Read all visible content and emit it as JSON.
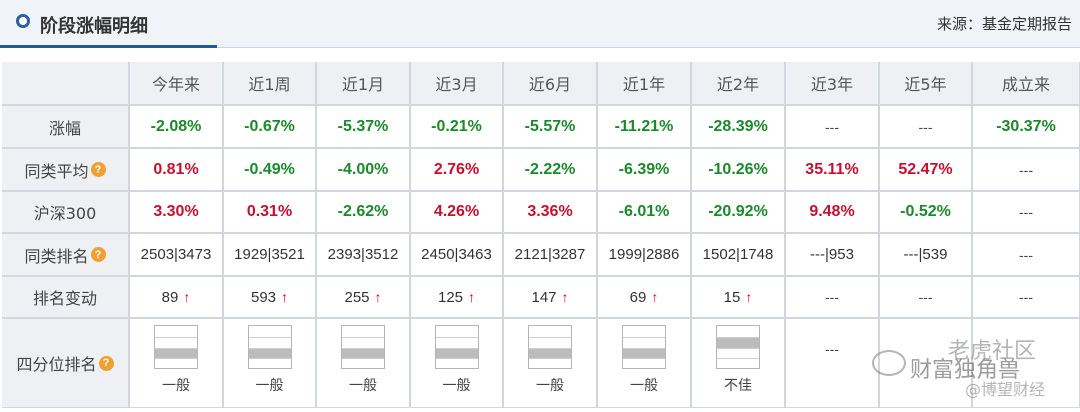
{
  "header": {
    "title": "阶段涨幅明细",
    "source": "来源：基金定期报告"
  },
  "columns": [
    "今年来",
    "近1周",
    "近1月",
    "近3月",
    "近6月",
    "近1年",
    "近2年",
    "近3年",
    "近5年",
    "成立来"
  ],
  "rows": {
    "change": {
      "label": "涨幅",
      "values": [
        "-2.08%",
        "-0.67%",
        "-5.37%",
        "-0.21%",
        "-5.57%",
        "-11.21%",
        "-28.39%",
        "---",
        "---",
        "-30.37%"
      ],
      "colors": [
        "green",
        "green",
        "green",
        "green",
        "green",
        "green",
        "green",
        "dash",
        "dash",
        "green"
      ]
    },
    "peer_avg": {
      "label": "同类平均",
      "values": [
        "0.81%",
        "-0.49%",
        "-4.00%",
        "2.76%",
        "-2.22%",
        "-6.39%",
        "-10.26%",
        "35.11%",
        "52.47%",
        "---"
      ],
      "colors": [
        "red",
        "green",
        "green",
        "red",
        "green",
        "green",
        "green",
        "red",
        "red",
        "dash"
      ]
    },
    "hs300": {
      "label": "沪深300",
      "values": [
        "3.30%",
        "0.31%",
        "-2.62%",
        "4.26%",
        "3.36%",
        "-6.01%",
        "-20.92%",
        "9.48%",
        "-0.52%",
        "---"
      ],
      "colors": [
        "red",
        "red",
        "green",
        "red",
        "red",
        "green",
        "green",
        "red",
        "green",
        "dash"
      ]
    },
    "peer_rank": {
      "label": "同类排名",
      "values": [
        "2503|3473",
        "1929|3521",
        "2393|3512",
        "2450|3463",
        "2121|3287",
        "1999|2886",
        "1502|1748",
        "---|953",
        "---|539",
        "---"
      ]
    },
    "rank_change": {
      "label": "排名变动",
      "values": [
        "89",
        "593",
        "255",
        "125",
        "147",
        "69",
        "15",
        "---",
        "---",
        "---"
      ],
      "arrows": [
        true,
        true,
        true,
        true,
        true,
        true,
        true,
        false,
        false,
        false
      ],
      "arrow_glyph": "↑"
    },
    "quartile": {
      "label": "四分位排名",
      "labels": [
        "一般",
        "一般",
        "一般",
        "一般",
        "一般",
        "一般",
        "不佳"
      ],
      "levels": [
        2,
        2,
        2,
        2,
        2,
        2,
        1
      ],
      "empty": [
        "---",
        "",
        ""
      ]
    }
  },
  "icons": {
    "question": "?"
  },
  "colors": {
    "green": "#1a8a2a",
    "red": "#c8102e",
    "accent": "#1f5a99"
  },
  "watermark": {
    "line1": "老虎社区",
    "line2": "财富独角兽",
    "line3": "@博望财经"
  }
}
